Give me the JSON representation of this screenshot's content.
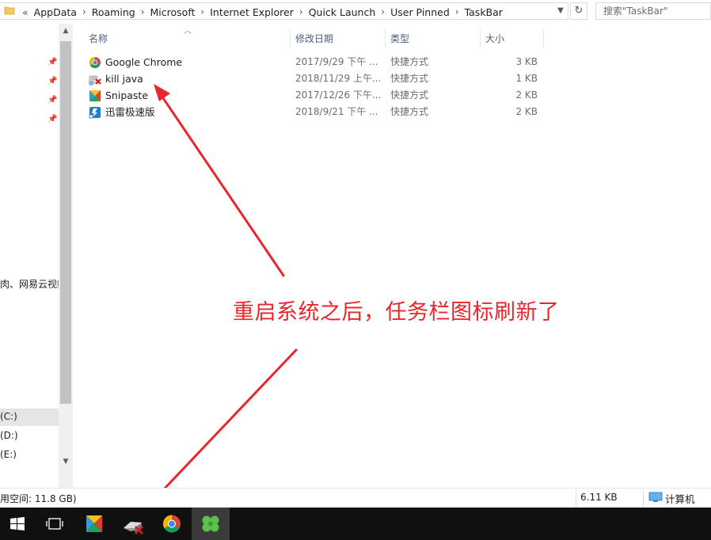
{
  "address_bar": {
    "lead": "«",
    "crumbs": [
      "AppData",
      "Roaming",
      "Microsoft",
      "Internet Explorer",
      "Quick Launch",
      "User Pinned",
      "TaskBar"
    ],
    "search_placeholder": "搜索\"TaskBar\""
  },
  "nav": {
    "partial_text": "肉、网易云视频",
    "drives": [
      "(C:)",
      "(D:)",
      "(E:)"
    ]
  },
  "columns": {
    "name": "名称",
    "date": "修改日期",
    "type": "类型",
    "size": "大小"
  },
  "files": [
    {
      "name": "Google Chrome",
      "date": "2017/9/29 下午 ...",
      "type": "快捷方式",
      "size": "3 KB",
      "icon": "chrome-icon"
    },
    {
      "name": "kill java",
      "date": "2018/11/29 上午...",
      "type": "快捷方式",
      "size": "1 KB",
      "icon": "kill-java-shortcut-icon"
    },
    {
      "name": "Snipaste",
      "date": "2017/12/26 下午...",
      "type": "快捷方式",
      "size": "2 KB",
      "icon": "snipaste-icon"
    },
    {
      "name": "迅雷极速版",
      "date": "2018/9/21 下午 ...",
      "type": "快捷方式",
      "size": "2 KB",
      "icon": "thunder-icon"
    }
  ],
  "annotation": "重启系统之后，任务栏图标刷新了",
  "status": {
    "free_space": "用空间: 11.8 GB)",
    "selection_size": "6.11 KB",
    "location": "计算机"
  },
  "taskbar": [
    "start-icon",
    "task-view-icon",
    "snipaste-icon",
    "kill-java-icon",
    "chrome-icon",
    "clover-app-icon"
  ],
  "colors": {
    "annotation_red": "#e8262c",
    "header_text": "#4c607a",
    "taskbar_bg": "#101010"
  }
}
